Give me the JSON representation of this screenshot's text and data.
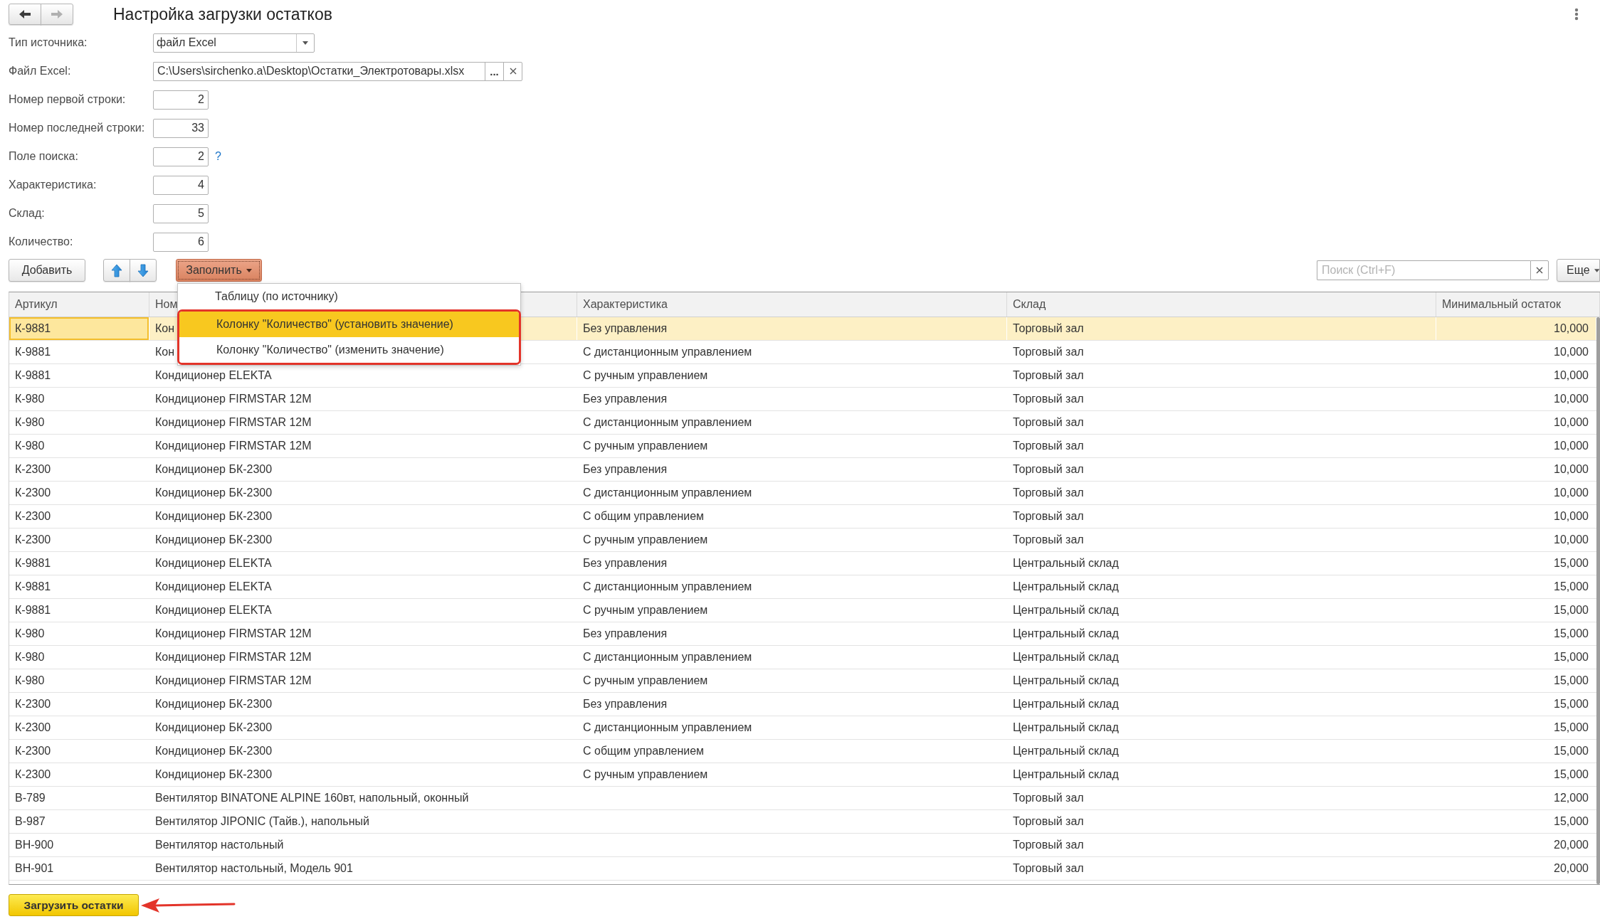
{
  "nav": {
    "back_enabled": true,
    "forward_enabled": false
  },
  "title": "Настройка загрузки остатков",
  "form": {
    "fields": [
      {
        "label": "Тип источника:",
        "kind": "select",
        "value": "файл Excel"
      },
      {
        "label": "Файл Excel:",
        "kind": "file",
        "value": "C:\\Users\\sirchenko.a\\Desktop\\Остатки_Электротовары.xlsx",
        "browse_label": "..."
      },
      {
        "label": "Номер первой строки:",
        "kind": "number",
        "value": "2"
      },
      {
        "label": "Номер последней строки:",
        "kind": "number",
        "value": "33"
      },
      {
        "label": "Поле поиска:",
        "kind": "number",
        "value": "2",
        "help": "?"
      },
      {
        "label": "Характеристика:",
        "kind": "number",
        "value": "4"
      },
      {
        "label": "Склад:",
        "kind": "number",
        "value": "5"
      },
      {
        "label": "Количество:",
        "kind": "number",
        "value": "6"
      }
    ]
  },
  "toolbar": {
    "add_button": "Добавить",
    "fill_button": {
      "label": "Заполнить",
      "open": true
    },
    "fill_menu": [
      {
        "label": "Таблицу (по источнику)",
        "selected": false,
        "marked": false
      },
      {
        "label": "Колонку \"Количество\" (установить значение)",
        "selected": true,
        "marked": true
      },
      {
        "label": "Колонку \"Количество\" (изменить значение)",
        "selected": false,
        "marked": true
      }
    ],
    "search": {
      "placeholder": "Поиск (Ctrl+F)"
    },
    "more_button": "Еще"
  },
  "table": {
    "columns": [
      "Артикул",
      "Ном",
      "Характеристика",
      "Склад",
      "Минимальный остаток"
    ],
    "rows": [
      {
        "article": "К-9881",
        "column_2": "Кон",
        "characteristic": "Без управления",
        "warehouse": "Торговый зал",
        "min_stock": "10,000",
        "selected": true
      },
      {
        "article": "К-9881",
        "column_2": "Кон",
        "characteristic": "С дистанционным управлением",
        "warehouse": "Торговый зал",
        "min_stock": "10,000",
        "selected": false
      },
      {
        "article": "К-9881",
        "column_2": "Кондиционер ELEKTA",
        "characteristic": "С ручным управлением",
        "warehouse": "Торговый зал",
        "min_stock": "10,000",
        "selected": false
      },
      {
        "article": "К-980",
        "column_2": "Кондиционер FIRMSTAR 12M",
        "characteristic": "Без управления",
        "warehouse": "Торговый зал",
        "min_stock": "10,000",
        "selected": false
      },
      {
        "article": "К-980",
        "column_2": "Кондиционер FIRMSTAR 12M",
        "characteristic": "С дистанционным управлением",
        "warehouse": "Торговый зал",
        "min_stock": "10,000",
        "selected": false
      },
      {
        "article": "К-980",
        "column_2": "Кондиционер FIRMSTAR 12M",
        "characteristic": "С ручным управлением",
        "warehouse": "Торговый зал",
        "min_stock": "10,000",
        "selected": false
      },
      {
        "article": "К-2300",
        "column_2": "Кондиционер БК-2300",
        "characteristic": "Без управления",
        "warehouse": "Торговый зал",
        "min_stock": "10,000",
        "selected": false
      },
      {
        "article": "К-2300",
        "column_2": "Кондиционер БК-2300",
        "characteristic": "С дистанционным управлением",
        "warehouse": "Торговый зал",
        "min_stock": "10,000",
        "selected": false
      },
      {
        "article": "К-2300",
        "column_2": "Кондиционер БК-2300",
        "characteristic": "С общим управлением",
        "warehouse": "Торговый зал",
        "min_stock": "10,000",
        "selected": false
      },
      {
        "article": "К-2300",
        "column_2": "Кондиционер БК-2300",
        "characteristic": "С ручным управлением",
        "warehouse": "Торговый зал",
        "min_stock": "10,000",
        "selected": false
      },
      {
        "article": "К-9881",
        "column_2": "Кондиционер ELEKTA",
        "characteristic": "Без управления",
        "warehouse": "Центральный склад",
        "min_stock": "15,000",
        "selected": false
      },
      {
        "article": "К-9881",
        "column_2": "Кондиционер ELEKTA",
        "characteristic": "С дистанционным управлением",
        "warehouse": "Центральный склад",
        "min_stock": "15,000",
        "selected": false
      },
      {
        "article": "К-9881",
        "column_2": "Кондиционер ELEKTA",
        "characteristic": "С ручным управлением",
        "warehouse": "Центральный склад",
        "min_stock": "15,000",
        "selected": false
      },
      {
        "article": "К-980",
        "column_2": "Кондиционер FIRMSTAR 12M",
        "characteristic": "Без управления",
        "warehouse": "Центральный склад",
        "min_stock": "15,000",
        "selected": false
      },
      {
        "article": "К-980",
        "column_2": "Кондиционер FIRMSTAR 12M",
        "characteristic": "С дистанционным управлением",
        "warehouse": "Центральный склад",
        "min_stock": "15,000",
        "selected": false
      },
      {
        "article": "К-980",
        "column_2": "Кондиционер FIRMSTAR 12M",
        "characteristic": "С ручным управлением",
        "warehouse": "Центральный склад",
        "min_stock": "15,000",
        "selected": false
      },
      {
        "article": "К-2300",
        "column_2": "Кондиционер БК-2300",
        "characteristic": "Без управления",
        "warehouse": "Центральный склад",
        "min_stock": "15,000",
        "selected": false
      },
      {
        "article": "К-2300",
        "column_2": "Кондиционер БК-2300",
        "characteristic": "С дистанционным управлением",
        "warehouse": "Центральный склад",
        "min_stock": "15,000",
        "selected": false
      },
      {
        "article": "К-2300",
        "column_2": "Кондиционер БК-2300",
        "characteristic": "С общим управлением",
        "warehouse": "Центральный склад",
        "min_stock": "15,000",
        "selected": false
      },
      {
        "article": "К-2300",
        "column_2": "Кондиционер БК-2300",
        "characteristic": "С ручным управлением",
        "warehouse": "Центральный склад",
        "min_stock": "15,000",
        "selected": false
      },
      {
        "article": "В-789",
        "column_2": "Вентилятор BINATONE ALPINE 160вт, напольный, оконный",
        "warehouse": "Торговый зал",
        "min_stock": "12,000",
        "selected": false
      },
      {
        "article": "В-987",
        "column_2": "Вентилятор JIPONIC (Тайв.), напольный",
        "warehouse": "Торговый зал",
        "min_stock": "15,000",
        "selected": false
      },
      {
        "article": "ВН-900",
        "column_2": "Вентилятор настольный",
        "warehouse": "Торговый зал",
        "min_stock": "20,000",
        "selected": false
      },
      {
        "article": "ВН-901",
        "column_2": "Вентилятор настольный, Модель 901",
        "warehouse": "Торговый зал",
        "min_stock": "20,000",
        "selected": false
      }
    ]
  },
  "load_button": {
    "label": "Загрузить остатки",
    "marked": true
  }
}
